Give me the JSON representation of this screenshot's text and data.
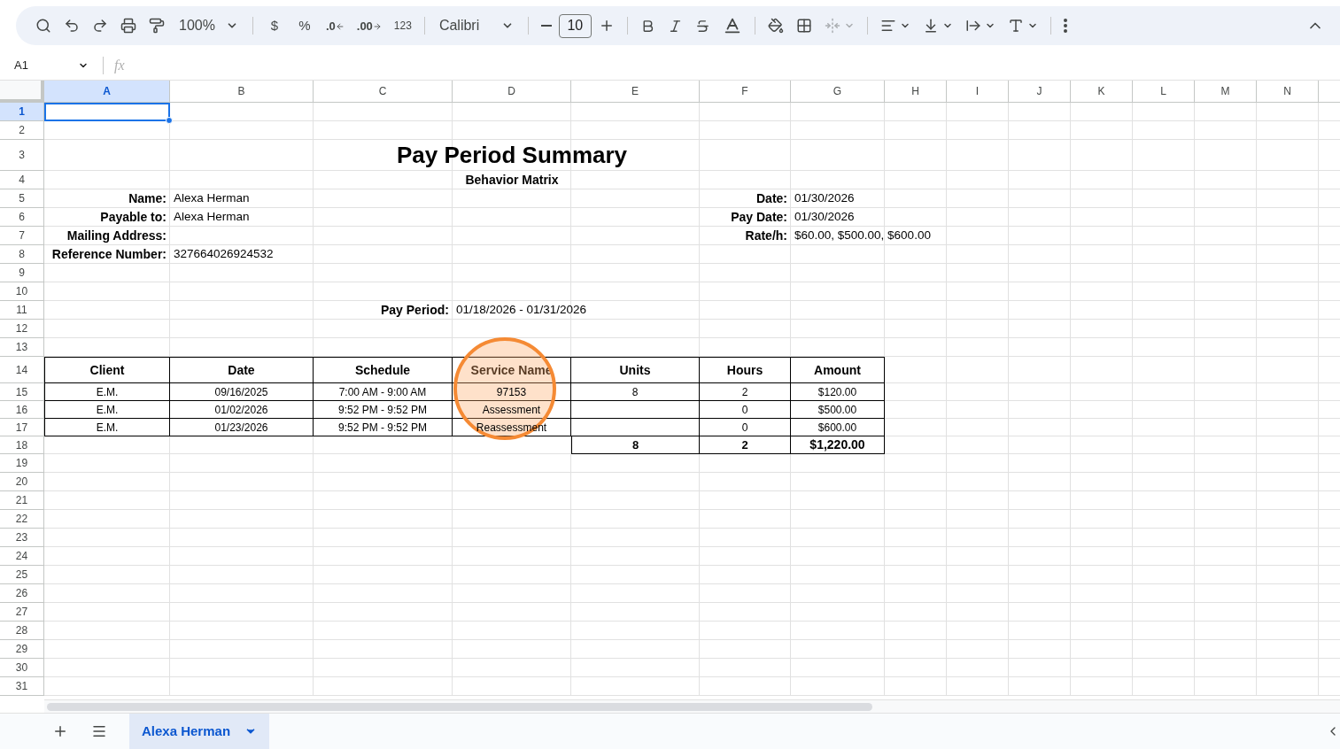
{
  "toolbar": {
    "zoom": "100%",
    "currency": "$",
    "percent": "%",
    "decrease_decimals": ".0",
    "increase_decimals": ".00",
    "number_format": "123",
    "font": "Calibri",
    "font_size": "10"
  },
  "formula_bar": {
    "name_box": "A1",
    "fx": "fx"
  },
  "columns": [
    {
      "label": "A",
      "selected": true
    },
    {
      "label": "B",
      "selected": false
    },
    {
      "label": "C",
      "selected": false
    },
    {
      "label": "D",
      "selected": false
    },
    {
      "label": "E",
      "selected": false
    },
    {
      "label": "F",
      "selected": false
    },
    {
      "label": "G",
      "selected": false
    },
    {
      "label": "H",
      "selected": false
    },
    {
      "label": "I",
      "selected": false
    },
    {
      "label": "J",
      "selected": false
    },
    {
      "label": "K",
      "selected": false
    },
    {
      "label": "L",
      "selected": false
    },
    {
      "label": "M",
      "selected": false
    },
    {
      "label": "N",
      "selected": false
    }
  ],
  "rows": [
    {
      "label": "1",
      "selected": true
    },
    {
      "label": "2",
      "selected": false
    },
    {
      "label": "3",
      "selected": false
    },
    {
      "label": "4",
      "selected": false
    },
    {
      "label": "5",
      "selected": false
    },
    {
      "label": "6",
      "selected": false
    },
    {
      "label": "7",
      "selected": false
    },
    {
      "label": "8",
      "selected": false
    },
    {
      "label": "9",
      "selected": false
    },
    {
      "label": "10",
      "selected": false
    },
    {
      "label": "11",
      "selected": false
    },
    {
      "label": "12",
      "selected": false
    },
    {
      "label": "13",
      "selected": false
    },
    {
      "label": "14",
      "selected": false
    },
    {
      "label": "15",
      "selected": false
    },
    {
      "label": "16",
      "selected": false
    },
    {
      "label": "17",
      "selected": false
    },
    {
      "label": "18",
      "selected": false
    },
    {
      "label": "19",
      "selected": false
    },
    {
      "label": "20",
      "selected": false
    },
    {
      "label": "21",
      "selected": false
    },
    {
      "label": "22",
      "selected": false
    },
    {
      "label": "23",
      "selected": false
    },
    {
      "label": "24",
      "selected": false
    },
    {
      "label": "25",
      "selected": false
    },
    {
      "label": "26",
      "selected": false
    },
    {
      "label": "27",
      "selected": false
    },
    {
      "label": "28",
      "selected": false
    },
    {
      "label": "29",
      "selected": false
    },
    {
      "label": "30",
      "selected": false
    },
    {
      "label": "31",
      "selected": false
    }
  ],
  "sheet": {
    "title": "Pay Period Summary",
    "subtitle": "Behavior Matrix",
    "left_fields": [
      {
        "label": "Name:",
        "value": "Alexa Herman"
      },
      {
        "label": "Payable to:",
        "value": "Alexa Herman"
      },
      {
        "label": "Mailing Address:"
      },
      {
        "label": "Reference Number:",
        "value": "327664026924532"
      }
    ],
    "right_fields": [
      {
        "label": "Date:",
        "value": "01/30/2026"
      },
      {
        "label": "Pay Date:",
        "value": "01/30/2026"
      },
      {
        "label": "Rate/h:",
        "value": "$60.00, $500.00, $600.00"
      }
    ],
    "pay_period": {
      "label": "Pay Period:",
      "value": "01/18/2026 - 01/31/2026"
    },
    "table": {
      "columns": [
        "Client",
        "Date",
        "Schedule",
        "Service Name",
        "Units",
        "Hours",
        "Amount"
      ],
      "rows": [
        {
          "client": "E.M.",
          "date": "09/16/2025",
          "schedule": "7:00 AM - 9:00 AM",
          "service_name": "97153",
          "units": "8",
          "hours": "2",
          "amount": "$120.00"
        },
        {
          "client": "E.M.",
          "date": "01/02/2026",
          "schedule": "9:52 PM - 9:52 PM",
          "service_name": "Assessment",
          "hours": "0",
          "amount": "$500.00"
        },
        {
          "client": "E.M.",
          "date": "01/23/2026",
          "schedule": "9:52 PM - 9:52 PM",
          "service_name": "Reassessment",
          "hours": "0",
          "amount": "$600.00"
        }
      ],
      "totals": {
        "units": "8",
        "hours": "2",
        "amount": "$1,220.00"
      }
    }
  },
  "sheet_tabs": [
    {
      "label": "Alexa Herman",
      "selected": true
    }
  ]
}
